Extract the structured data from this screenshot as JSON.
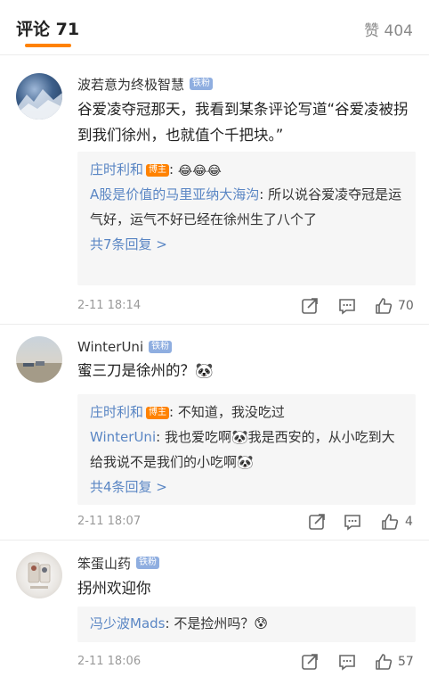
{
  "header": {
    "comments_tab": "评论 71",
    "likes_tab": "赞 404",
    "accent_color": "#ff8200"
  },
  "comments": [
    {
      "username": "波若意为终极智慧",
      "badge": "铁粉",
      "text": "谷爱凌夺冠那天，我看到某条评论写道“谷爱凌被拐到我们徐州，也就值个千把块。”",
      "replies": [
        {
          "author": "庄时利和",
          "badge": "博主",
          "text": "😂😂😂"
        },
        {
          "author": "A股是价值的马里亚纳大海沟",
          "text": "所以说谷爱凌夺冠是运气好，运气不好已经在徐州生了八个了"
        }
      ],
      "more_replies": "共7条回复 >",
      "time": "2-11 18:14",
      "likes": "70"
    },
    {
      "username": "WinterUni",
      "badge": "铁粉",
      "text": "蜜三刀是徐州的？🐼",
      "replies": [
        {
          "author": "庄时利和",
          "badge": "博主",
          "text": "不知道，我没吃过"
        },
        {
          "author": "WinterUni",
          "text": "我也爱吃啊🐼我是西安的，从小吃到大给我说不是我们的小吃啊🐼"
        }
      ],
      "more_replies": "共4条回复 >",
      "time": "2-11 18:07",
      "likes": "4"
    },
    {
      "username": "笨蛋山药",
      "badge": "铁粉",
      "text": "拐州欢迎你",
      "replies": [
        {
          "author": "冯少波Mads",
          "text": "不是捡州吗？😰"
        }
      ],
      "time": "2-11 18:06",
      "likes": "57"
    }
  ],
  "icons": [
    "share-icon",
    "comment-icon",
    "like-icon",
    "panda-emoji",
    "laugh-emoji"
  ]
}
